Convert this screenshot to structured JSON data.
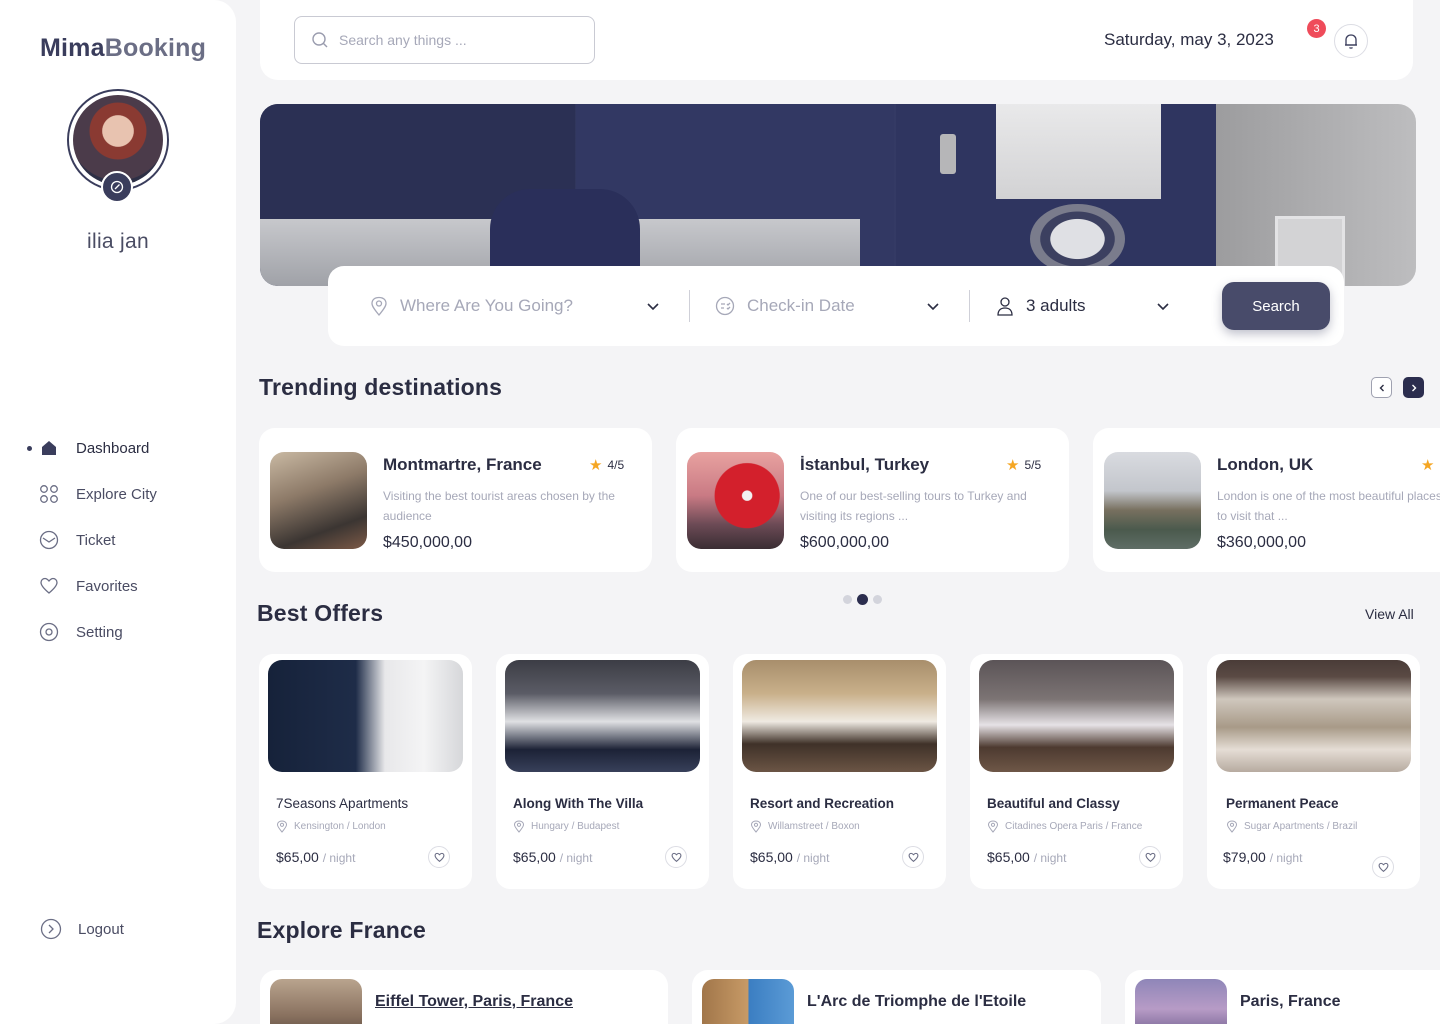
{
  "brand": {
    "name_part1": "Mima",
    "name_part2": "Booking"
  },
  "user": {
    "name": "ilia jan"
  },
  "nav": [
    {
      "label": "Dashboard",
      "icon": "home-icon",
      "active": true
    },
    {
      "label": "Explore City",
      "icon": "grid-icon"
    },
    {
      "label": "Ticket",
      "icon": "mail-icon"
    },
    {
      "label": "Favorites",
      "icon": "heart-icon"
    },
    {
      "label": "Setting",
      "icon": "settings-icon"
    }
  ],
  "logout": {
    "label": "Logout"
  },
  "topbar": {
    "search_placeholder": "Search any things ...",
    "date": "Saturday, may 3, 2023",
    "notification_count": "3"
  },
  "filter": {
    "destination_placeholder": "Where Are You Going?",
    "checkin_placeholder": "Check-in Date",
    "guests": "3 adults",
    "search_label": "Search"
  },
  "trending": {
    "title": "Trending destinations",
    "cards": [
      {
        "name": "Montmartre, France",
        "rating": "4/5",
        "desc": "Visiting the best tourist areas chosen by the audience",
        "price": "$450,000,00"
      },
      {
        "name": "İstanbul, Turkey",
        "rating": "5/5",
        "desc": "One of our best-selling tours to Turkey and visiting its regions ...",
        "price": "$600,000,00"
      },
      {
        "name": "London, UK",
        "rating": "",
        "desc": "London is one of the most beautiful places to visit that ...",
        "price": "$360,000,00"
      }
    ]
  },
  "offers": {
    "title": "Best Offers",
    "view_all": "View All",
    "per_night": "/ night",
    "cards": [
      {
        "title": "7Seasons Apartments",
        "location": "Kensington / London",
        "price": "$65,00"
      },
      {
        "title": "Along With The Villa",
        "location": "Hungary / Budapest",
        "price": "$65,00"
      },
      {
        "title": "Resort and Recreation",
        "location": "Willamstreet / Boxon",
        "price": "$65,00"
      },
      {
        "title": "Beautiful and Classy",
        "location": "Citadines Opera Paris / France",
        "price": "$65,00"
      },
      {
        "title": "Permanent Peace",
        "location": "Sugar Apartments / Brazil",
        "price": "$79,00"
      }
    ]
  },
  "explore": {
    "title": "Explore France",
    "cards": [
      {
        "name": "Eiffel Tower, Paris, France"
      },
      {
        "name": "L'Arc de Triomphe de l'Etoile"
      },
      {
        "name": "Paris, France"
      }
    ]
  },
  "colors": {
    "primary": "#3a3d5c",
    "accent_star": "#f5a623",
    "badge": "#ef4b5a",
    "background": "#f4f4f6"
  }
}
